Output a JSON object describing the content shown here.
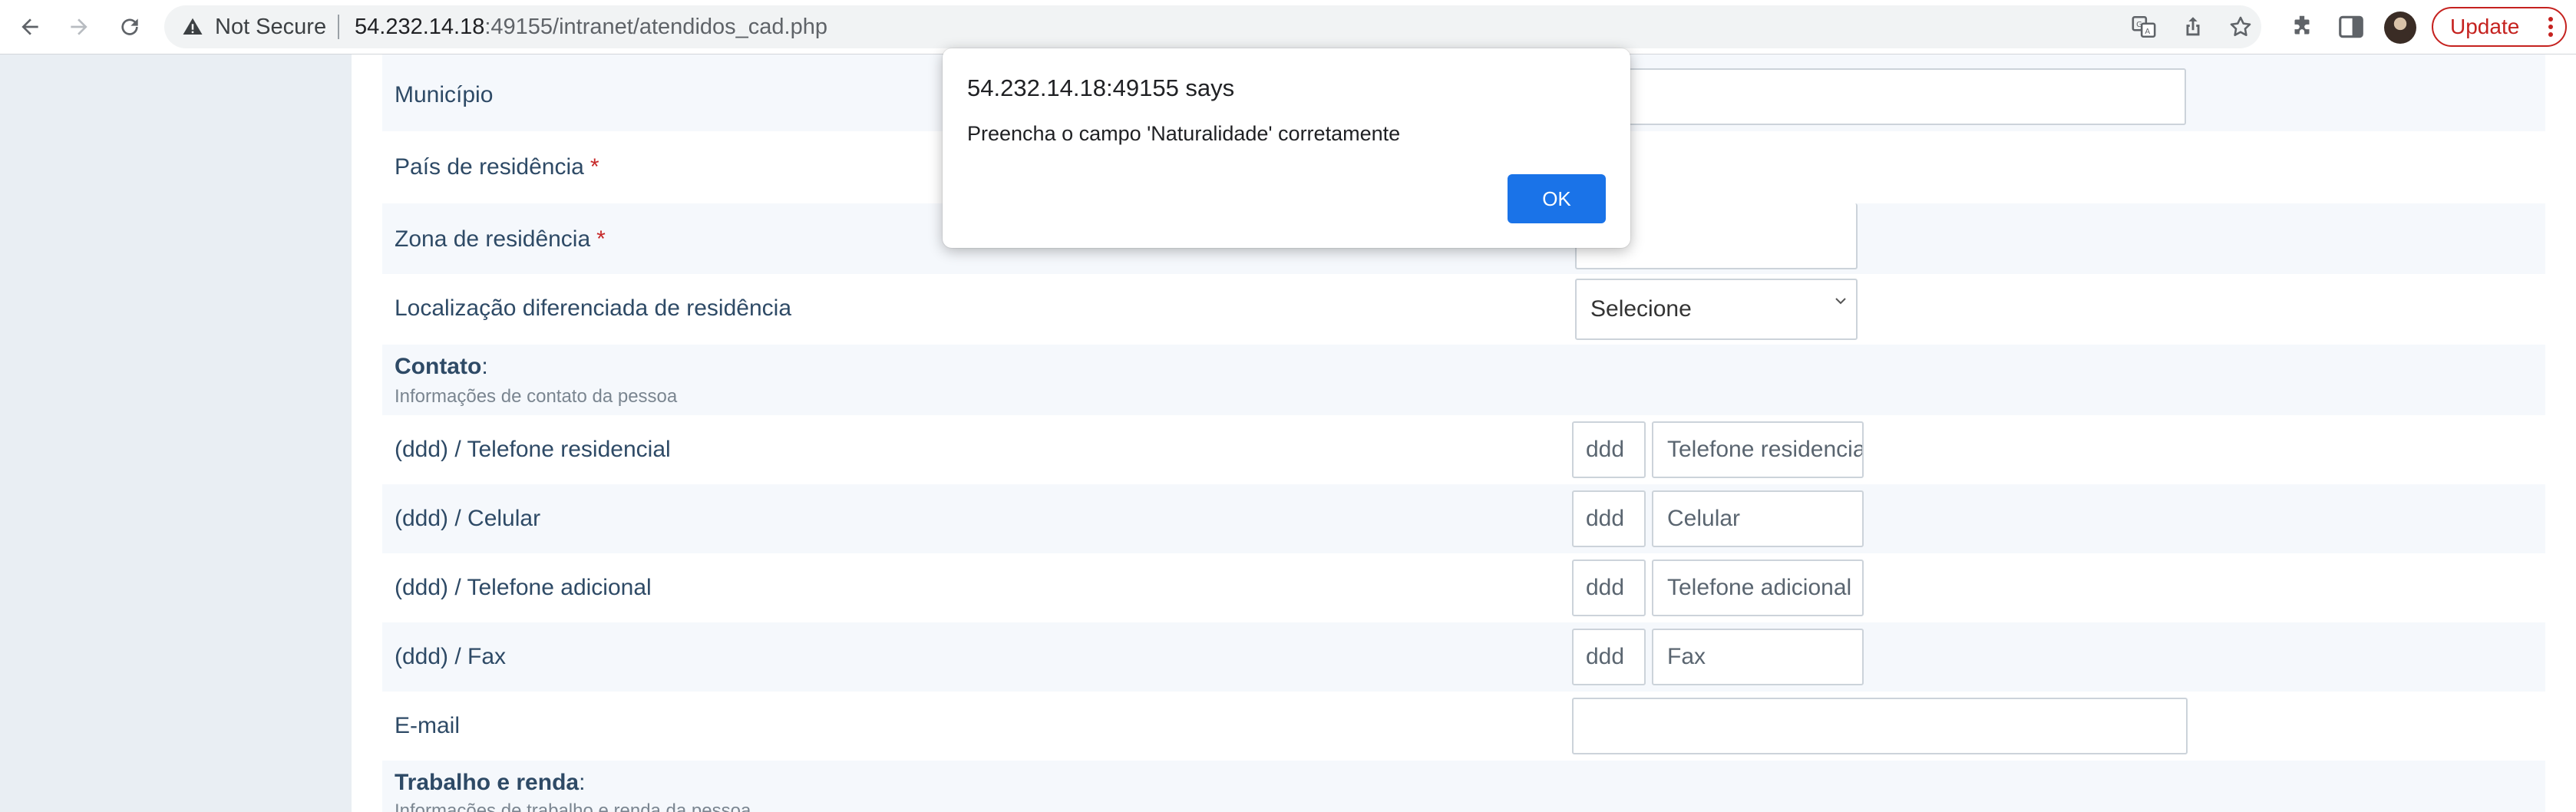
{
  "browser": {
    "security_label": "Not Secure",
    "url_host": "54.232.14.18",
    "url_rest": ":49155/intranet/atendidos_cad.php",
    "update_label": "Update"
  },
  "form": {
    "rows": {
      "municipio": {
        "label": "Município"
      },
      "pais": {
        "label": "País de residência",
        "required": "*"
      },
      "zona": {
        "label": "Zona de residência",
        "required": "*"
      },
      "localizacao": {
        "label": "Localização diferenciada de residência",
        "value": "Selecione"
      },
      "contato": {
        "title": "Contato",
        "colon": ":",
        "subtitle": "Informações de contato da pessoa"
      },
      "tel_res": {
        "label": "(ddd) / Telefone residencial",
        "ddd": "ddd",
        "placeholder": "Telefone residencial"
      },
      "celular": {
        "label": "(ddd) / Celular",
        "ddd": "ddd",
        "placeholder": "Celular"
      },
      "tel_adic": {
        "label": "(ddd) / Telefone adicional",
        "ddd": "ddd",
        "placeholder": "Telefone adicional"
      },
      "fax": {
        "label": "(ddd) / Fax",
        "ddd": "ddd",
        "placeholder": "Fax"
      },
      "email": {
        "label": "E-mail"
      },
      "trabalho": {
        "title": "Trabalho e renda",
        "colon": ":",
        "subtitle": "Informações de trabalho e renda da pessoa"
      }
    }
  },
  "dialog": {
    "title": "54.232.14.18:49155 says",
    "message": "Preencha o campo 'Naturalidade' corretamente",
    "ok_label": "OK"
  }
}
